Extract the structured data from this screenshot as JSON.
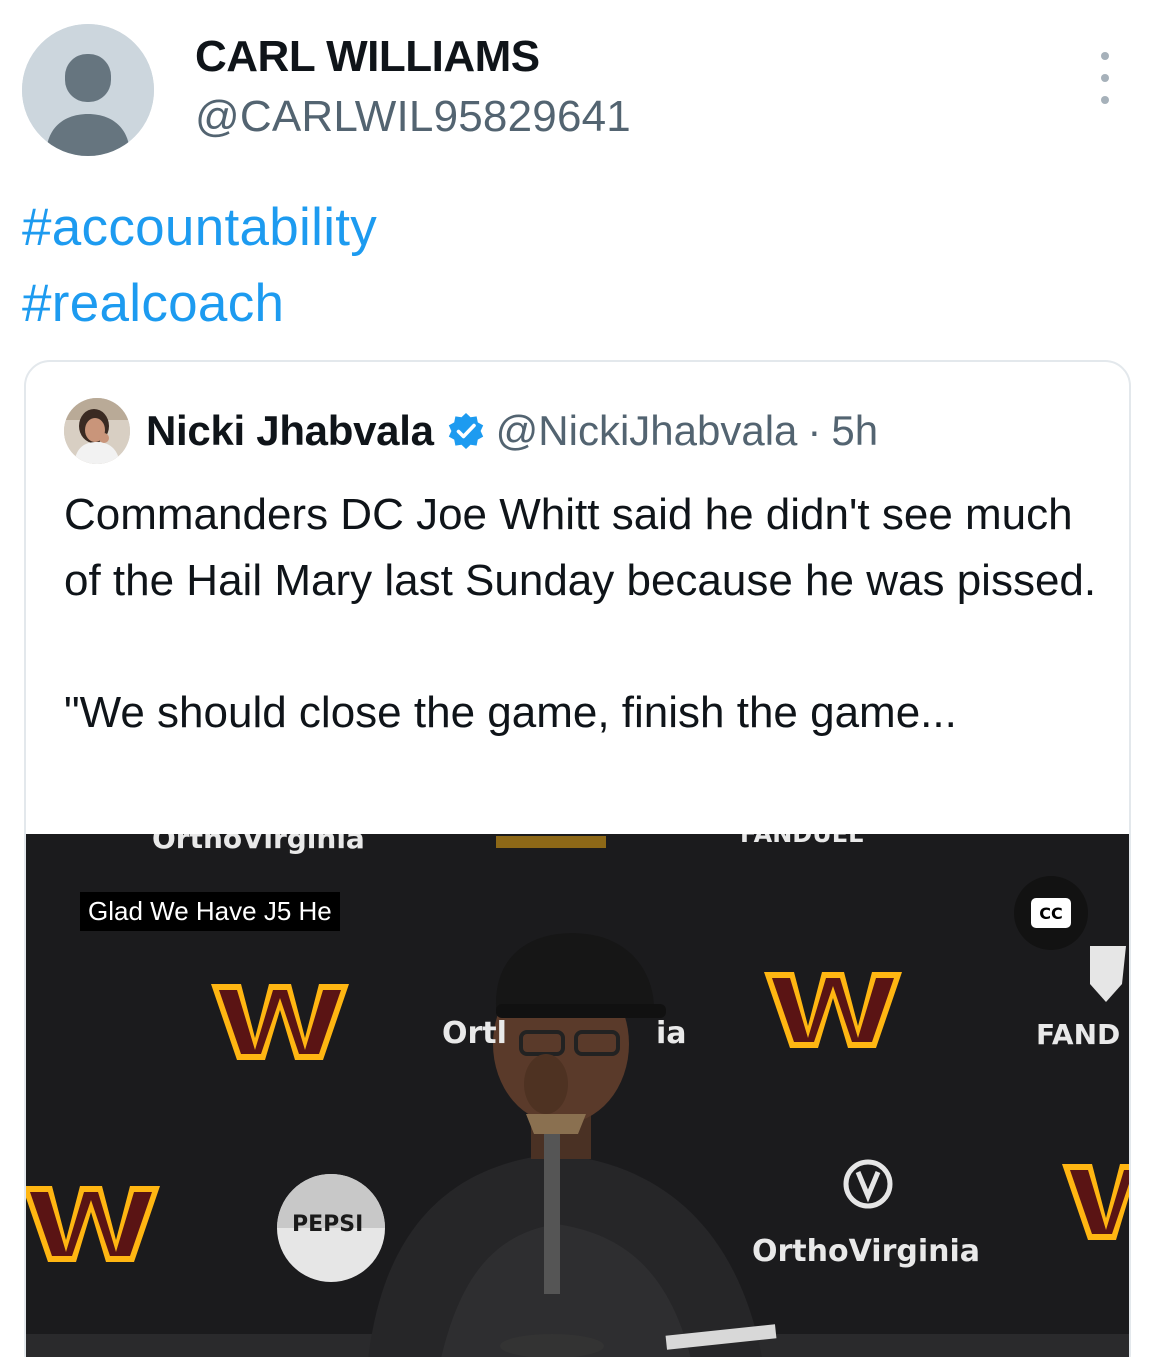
{
  "author": {
    "display_name": "CARL WILLIAMS",
    "handle": "@CARLWIL95829641"
  },
  "post": {
    "hashtags": [
      "#accountability",
      "#realcoach"
    ]
  },
  "quoted_tweet": {
    "author_name": "Nicki Jhabvala",
    "author_handle": "@NickiJhabvala",
    "separator": "·",
    "time": "5h",
    "text_p1": "Commanders DC Joe Whitt said he didn't see much of the Hail Mary last Sunday because he was pissed.",
    "text_p2": "\"We should close the game, finish the game..."
  },
  "video": {
    "caption": "Glad We Have J5 He",
    "cc_label": "CC",
    "backdrop": {
      "sponsor_top_left": "OrthoVirginia",
      "sponsor_top_right": "FANDUEL",
      "sponsor_mid_left": "Ortl",
      "sponsor_mid_right": "ia",
      "sponsor_right": "FAND",
      "sponsor_bottom": "OrthoVirginia",
      "pepsi": "PEPSI"
    }
  },
  "colors": {
    "link": "#1d9bf0",
    "secondary_text": "#536471",
    "verified": "#1d9bf0",
    "commanders_burgundy": "#5a1414",
    "commanders_gold": "#ffb612"
  },
  "icons": [
    "user-avatar-icon",
    "more-options-icon",
    "verified-badge-icon",
    "closed-captions-icon",
    "commanders-w-logo"
  ]
}
